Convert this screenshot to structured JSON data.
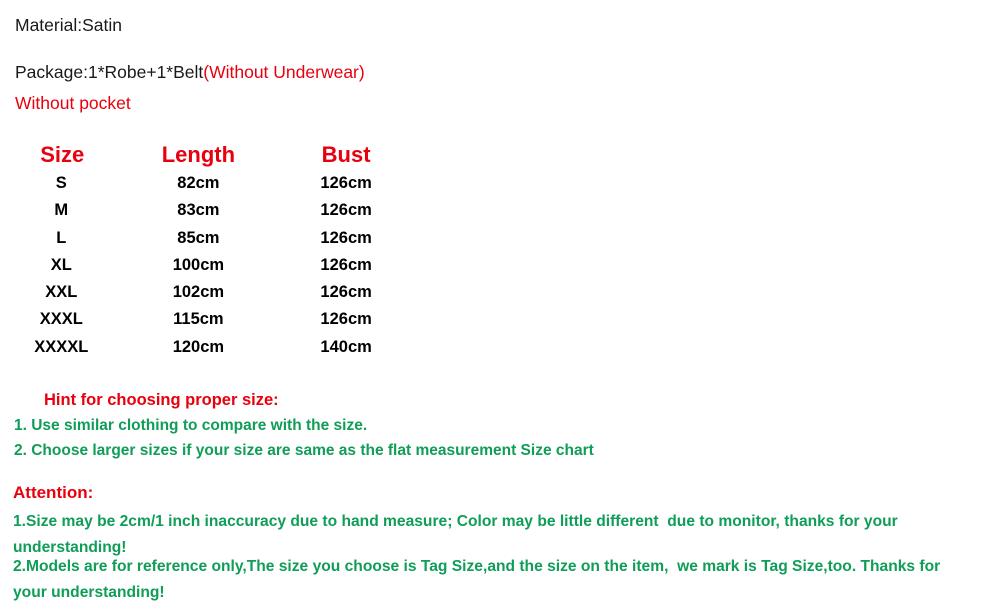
{
  "product_info": {
    "material_line": "Material:Satin",
    "package_label": "Package:1*Robe+1*Belt",
    "package_note": "(Without Underwear)",
    "pocket_note": "Without pocket"
  },
  "size_chart": {
    "headers": [
      "Size",
      "Length",
      "Bust"
    ],
    "rows": [
      {
        "size": "S",
        "length": "82cm",
        "bust": "126cm"
      },
      {
        "size": "M",
        "length": "83cm",
        "bust": "126cm"
      },
      {
        "size": "L",
        "length": "85cm",
        "bust": "126cm"
      },
      {
        "size": "XL",
        "length": "100cm",
        "bust": "126cm"
      },
      {
        "size": "XXL",
        "length": "102cm",
        "bust": "126cm"
      },
      {
        "size": "XXXL",
        "length": "115cm",
        "bust": "126cm"
      },
      {
        "size": "XXXXL",
        "length": "120cm",
        "bust": "140cm"
      }
    ]
  },
  "hint": {
    "title": "Hint for choosing proper size:",
    "items": [
      "1. Use similar clothing to compare with the size.",
      "2. Choose larger sizes if your size are same as the flat measurement Size chart"
    ]
  },
  "attention": {
    "title": "Attention:",
    "items": [
      "1.Size may be 2cm/1 inch inaccuracy due to hand measure; Color may be little different  due to monitor, thanks for your understanding!",
      "2.Models are for reference only,The size you choose is Tag Size,and the size on the item,  we mark is Tag Size,too. Thanks for your understanding!"
    ]
  },
  "colors": {
    "red": "#e8000e",
    "green": "#0f9d58",
    "black": "#000000",
    "background": "#ffffff"
  }
}
